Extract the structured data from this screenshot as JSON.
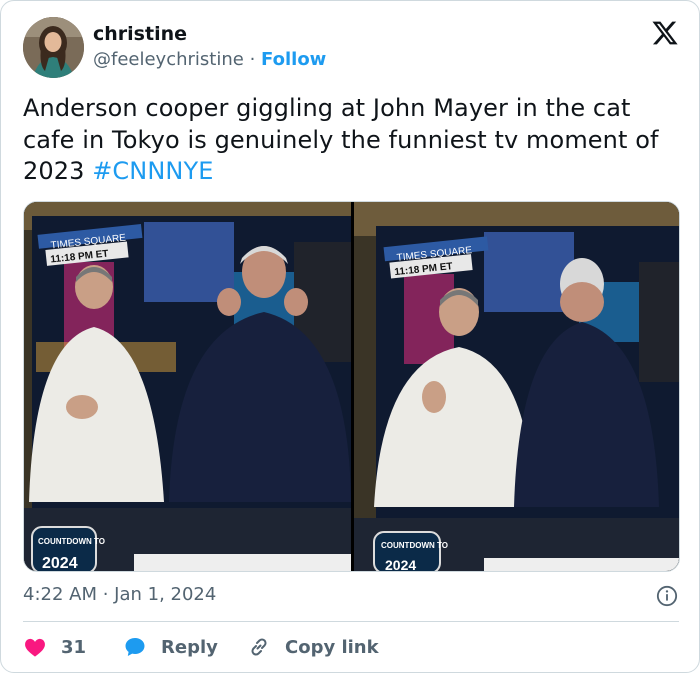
{
  "author": {
    "name": "christine",
    "handle": "@feeleychristine",
    "separator": "·",
    "follow_label": "Follow"
  },
  "tweet": {
    "text": "Anderson cooper giggling at John Mayer in the cat cafe in Tokyo is genuinely the funniest tv moment of 2023 ",
    "hashtag": "#CNNNYE",
    "timestamp": "4:22 AM · Jan 1, 2024"
  },
  "media": {
    "photos": [
      {
        "overlay_title": "TIMES SQUARE",
        "overlay_time": "11:18 PM ET",
        "countdown_label": "COUNTDOWN TO",
        "countdown_year": "2024"
      },
      {
        "overlay_title": "TIMES SQUARE",
        "overlay_time": "11:18 PM ET",
        "countdown_label": "COUNTDOWN TO",
        "countdown_year": "2024"
      }
    ]
  },
  "actions": {
    "like_count": "31",
    "reply_label": "Reply",
    "copy_label": "Copy link"
  },
  "icons": {
    "avatar": "avatar-photo",
    "brand": "x-logo-icon",
    "info": "info-icon",
    "like": "heart-icon",
    "reply": "reply-bubble-icon",
    "copy": "link-icon"
  },
  "colors": {
    "accent": "#1d9bf0",
    "like": "#f91880",
    "text": "#0f1419",
    "muted": "#536471"
  }
}
